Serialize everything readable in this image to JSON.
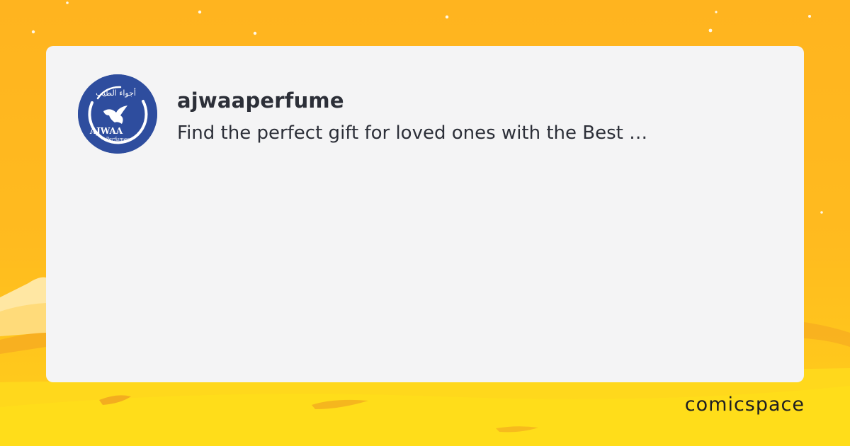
{
  "profile": {
    "username": "ajwaaperfume",
    "description": "Find the perfect gift for loved ones with the Best …",
    "avatar": {
      "icon": "ajwaa-perfumes-logo-icon",
      "arabic_text": "أجواء الطيب",
      "brand_text": "AJWAA",
      "sub_text": "Perfumes",
      "background_color": "#2e4d9e"
    }
  },
  "footer": {
    "brand_logo_text": "comicspace"
  },
  "colors": {
    "background_top": "#ffb41f",
    "background_bottom": "#ffd51a",
    "card": "#f4f4f5",
    "text": "#2c2f38"
  }
}
